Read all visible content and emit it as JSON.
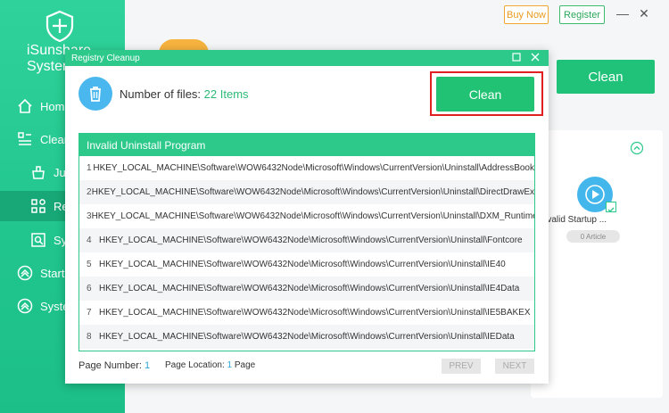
{
  "app": {
    "title": "iSunshare System ...",
    "title_line1": "iSunshare",
    "title_line2": "System"
  },
  "sidebar": {
    "items": [
      {
        "label": "Home",
        "icon": "home-icon"
      },
      {
        "label": "Clean",
        "icon": "clean-icon"
      },
      {
        "label": "Ju",
        "icon": "junk-icon"
      },
      {
        "label": "Re",
        "icon": "registry-icon"
      },
      {
        "label": "Sy",
        "icon": "system-icon"
      },
      {
        "label": "Startu",
        "icon": "startup-icon"
      },
      {
        "label": "Syste",
        "icon": "system-tools-icon"
      }
    ]
  },
  "topbar": {
    "buy_now": "Buy Now",
    "register": "Register",
    "minimize": "—",
    "close": "✕"
  },
  "main": {
    "clean_label": "Clean",
    "card": {
      "label": "Invalid Startup ...",
      "badge": "0 Article"
    }
  },
  "dialog": {
    "title": "Registry Cleanup",
    "files_label": "Number of files:",
    "files_count": "22 Items",
    "clean_label": "Clean",
    "list_title": "Invalid Uninstall Program",
    "rows": [
      {
        "num": "1",
        "key": "HKEY_LOCAL_MACHINE\\Software\\WOW6432Node\\Microsoft\\Windows\\CurrentVersion\\Uninstall\\AddressBook"
      },
      {
        "num": "2",
        "key": "HKEY_LOCAL_MACHINE\\Software\\WOW6432Node\\Microsoft\\Windows\\CurrentVersion\\Uninstall\\DirectDrawEx"
      },
      {
        "num": "3",
        "key": "HKEY_LOCAL_MACHINE\\Software\\WOW6432Node\\Microsoft\\Windows\\CurrentVersion\\Uninstall\\DXM_Runtime"
      },
      {
        "num": "4",
        "key": "HKEY_LOCAL_MACHINE\\Software\\WOW6432Node\\Microsoft\\Windows\\CurrentVersion\\Uninstall\\Fontcore"
      },
      {
        "num": "5",
        "key": "HKEY_LOCAL_MACHINE\\Software\\WOW6432Node\\Microsoft\\Windows\\CurrentVersion\\Uninstall\\IE40"
      },
      {
        "num": "6",
        "key": "HKEY_LOCAL_MACHINE\\Software\\WOW6432Node\\Microsoft\\Windows\\CurrentVersion\\Uninstall\\IE4Data"
      },
      {
        "num": "7",
        "key": "HKEY_LOCAL_MACHINE\\Software\\WOW6432Node\\Microsoft\\Windows\\CurrentVersion\\Uninstall\\IE5BAKEX"
      },
      {
        "num": "8",
        "key": "HKEY_LOCAL_MACHINE\\Software\\WOW6432Node\\Microsoft\\Windows\\CurrentVersion\\Uninstall\\IEData"
      }
    ],
    "page_number_label": "Page Number:",
    "page_number": "1",
    "page_location_label": "Page Location:",
    "page_location": "1",
    "page_location_suffix": "Page",
    "prev": "PREV",
    "next": "NEXT"
  },
  "colors": {
    "brand_green": "#2cc98b",
    "clean_button": "#21c274",
    "highlight_border": "#e02020",
    "trash_blue": "#4ab8ee",
    "count_green": "#2cba77"
  }
}
